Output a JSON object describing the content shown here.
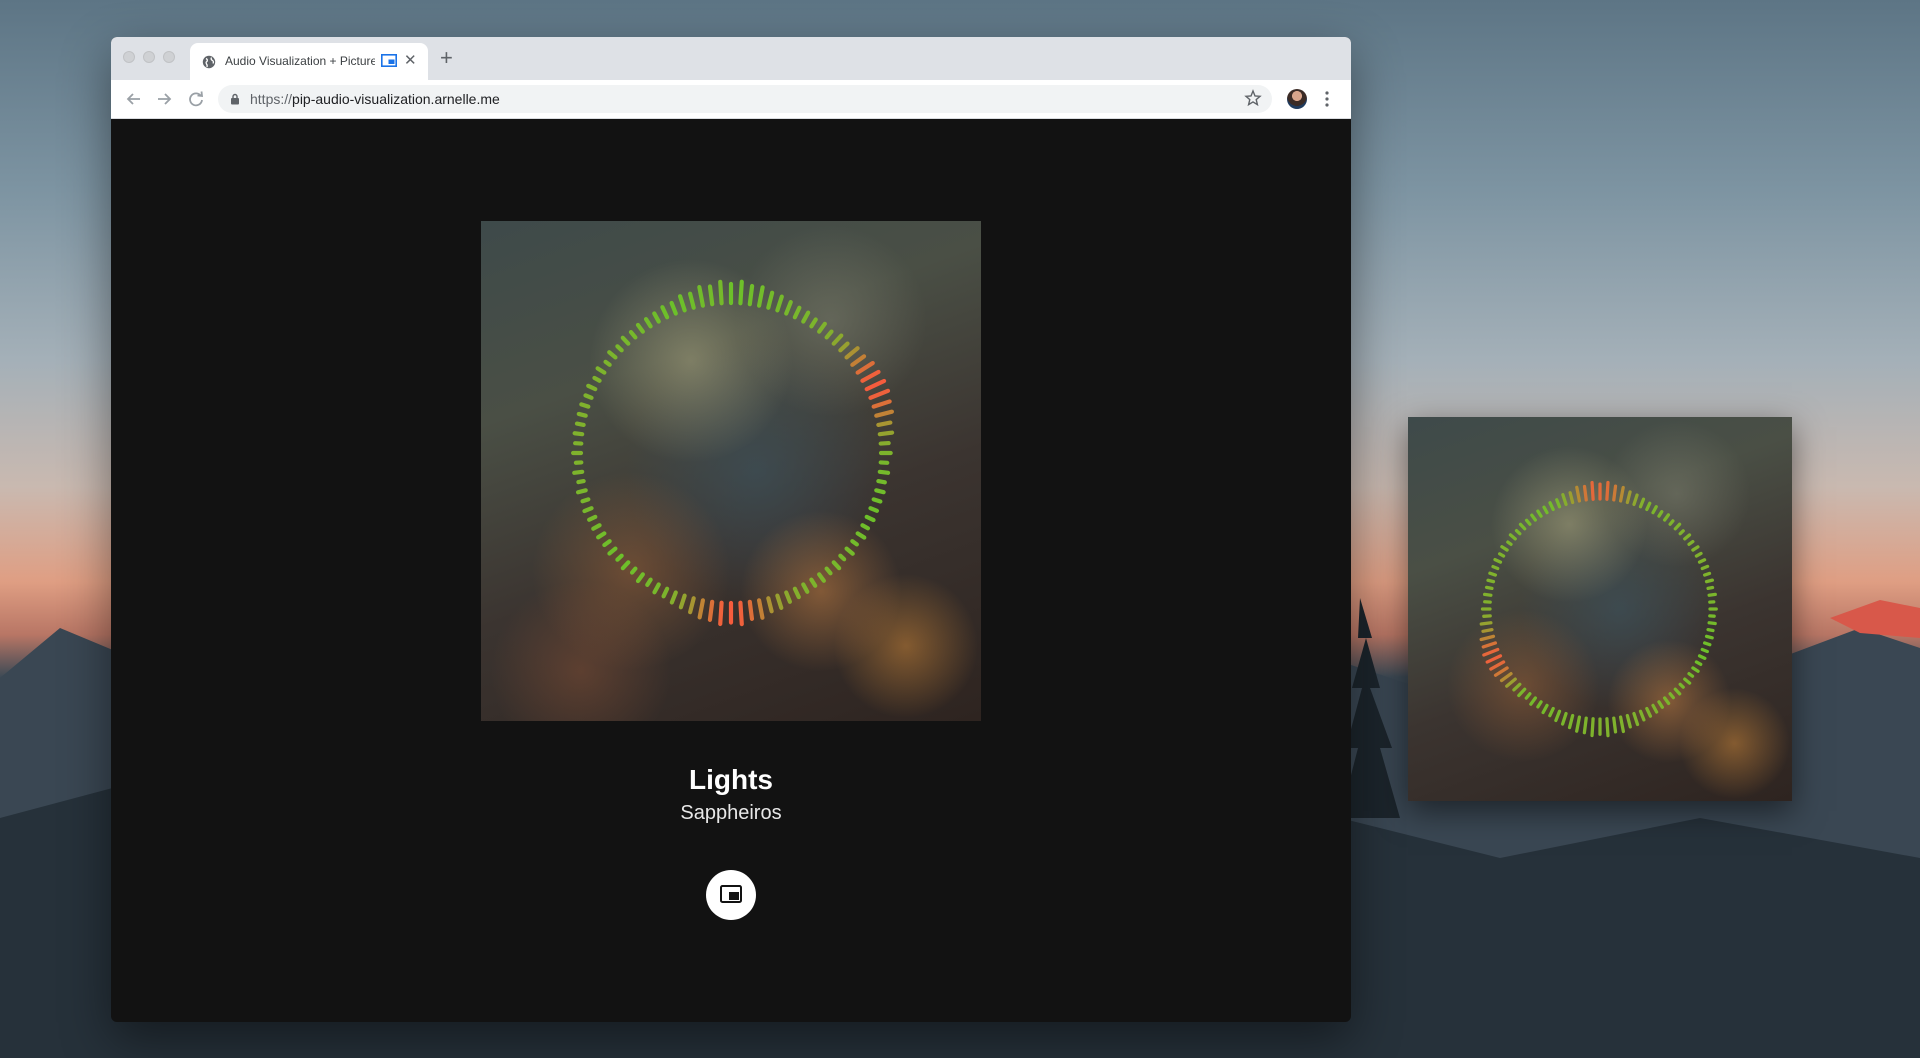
{
  "browser": {
    "tab_title": "Audio Visualization + Picture-in-Picture",
    "url_scheme": "https://",
    "url_host": "pip-audio-visualization.arnelle.me"
  },
  "player": {
    "song_title": "Lights",
    "artist": "Sappheiros"
  },
  "icons": {
    "tab_favicon": "globe-icon",
    "tab_audio": "picture-in-picture-icon",
    "back": "arrow-left-icon",
    "forward": "arrow-right-icon",
    "reload": "reload-icon",
    "lock": "lock-icon",
    "bookmark": "star-icon",
    "menu": "kebab-menu-icon",
    "pip_button": "picture-in-picture-icon"
  },
  "colors": {
    "page_background": "#121212",
    "viz_green": "#6cc02a",
    "viz_orange": "#f0603c"
  }
}
